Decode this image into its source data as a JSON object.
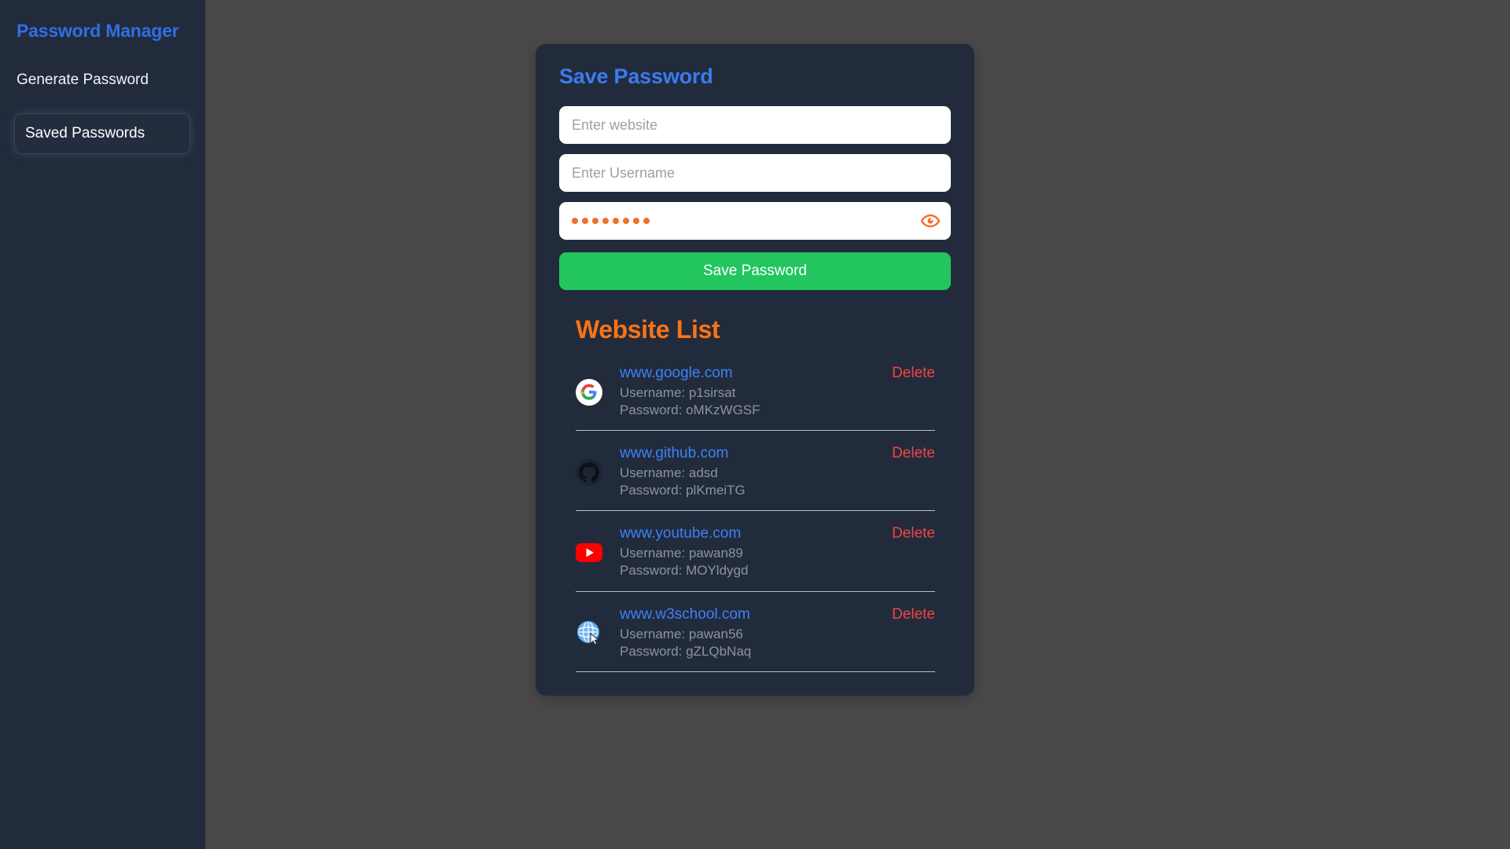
{
  "sidebar": {
    "title": "Password Manager",
    "generate_label": "Generate Password",
    "saved_label": "Saved Passwords"
  },
  "card": {
    "title": "Save Password",
    "website_input": {
      "value": "",
      "placeholder": "Enter website"
    },
    "username_input": {
      "value": "",
      "placeholder": "Enter Username"
    },
    "password_input": {
      "value": "",
      "placeholder": "",
      "masked_char_count": 8,
      "dot_color": "#f2702a"
    },
    "eye_icon": "eye-icon",
    "save_button_label": "Save Password"
  },
  "website_list": {
    "title": "Website List",
    "delete_label": "Delete",
    "username_prefix": "Username: ",
    "password_prefix": "Password: ",
    "entries": [
      {
        "icon": "google-icon",
        "site": "www.google.com",
        "username_line": "Username: p1sirsat",
        "password_line": "Password: oMKzWGSF",
        "delete_label": "Delete"
      },
      {
        "icon": "github-icon",
        "site": "www.github.com",
        "username_line": "Username: adsd",
        "password_line": "Password: plKmeiTG",
        "delete_label": "Delete"
      },
      {
        "icon": "youtube-icon",
        "site": "www.youtube.com",
        "username_line": "Username: pawan89",
        "password_line": "Password: MOYldygd",
        "delete_label": "Delete"
      },
      {
        "icon": "globe-cursor-icon",
        "site": "www.w3school.com",
        "username_line": "Username: pawan56",
        "password_line": "Password: gZLQbNaq",
        "delete_label": "Delete"
      }
    ]
  },
  "colors": {
    "page_background": "#4a4848",
    "panel_background": "#222b3c",
    "brand_blue": "#3b7bf0",
    "accent_orange": "#f97316",
    "success_green": "#22c55e",
    "danger_red": "#ef4444",
    "link_blue": "#3b82f6",
    "muted_text": "#8d939e"
  }
}
